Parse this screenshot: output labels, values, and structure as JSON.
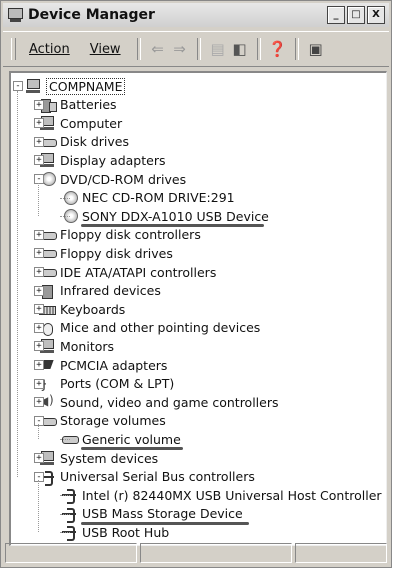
{
  "window": {
    "title": "Device Manager",
    "min_label": "_",
    "max_label": "□",
    "close_label": "X"
  },
  "menu": {
    "action": "Action",
    "view": "View"
  },
  "toolbar_icons": [
    "back-arrow-icon",
    "forward-arrow-icon",
    "properties-icon",
    "show-hide-icon",
    "help-icon",
    "scan-hardware-icon"
  ],
  "tree": {
    "root": "COMPNAME",
    "items": [
      {
        "label": "Batteries",
        "icon": "battery-icon",
        "expanded": false
      },
      {
        "label": "Computer",
        "icon": "computer-icon",
        "expanded": false
      },
      {
        "label": "Disk drives",
        "icon": "disk-drive-icon",
        "expanded": false
      },
      {
        "label": "Display adapters",
        "icon": "monitor-icon",
        "expanded": false
      },
      {
        "label": "DVD/CD-ROM drives",
        "icon": "cdrom-icon",
        "expanded": true,
        "children": [
          {
            "label": "NEC CD-ROM DRIVE:291",
            "icon": "cdrom-icon"
          },
          {
            "label": "SONY DDX-A1010 USB Device",
            "icon": "cdrom-icon",
            "underlined": true
          }
        ]
      },
      {
        "label": "Floppy disk controllers",
        "icon": "floppy-controller-icon",
        "expanded": false
      },
      {
        "label": "Floppy disk drives",
        "icon": "floppy-drive-icon",
        "expanded": false
      },
      {
        "label": "IDE ATA/ATAPI controllers",
        "icon": "ide-controller-icon",
        "expanded": false
      },
      {
        "label": "Infrared devices",
        "icon": "infrared-icon",
        "expanded": false
      },
      {
        "label": "Keyboards",
        "icon": "keyboard-icon",
        "expanded": false
      },
      {
        "label": "Mice and other pointing devices",
        "icon": "mouse-icon",
        "expanded": false
      },
      {
        "label": "Monitors",
        "icon": "monitor-icon",
        "expanded": false
      },
      {
        "label": "PCMCIA adapters",
        "icon": "pcmcia-icon",
        "expanded": false
      },
      {
        "label": "Ports (COM & LPT)",
        "icon": "port-icon",
        "expanded": false
      },
      {
        "label": "Sound, video and game controllers",
        "icon": "sound-icon",
        "expanded": false
      },
      {
        "label": "Storage volumes",
        "icon": "storage-volume-icon",
        "expanded": true,
        "children": [
          {
            "label": "Generic volume",
            "icon": "storage-volume-icon",
            "underlined": true
          }
        ]
      },
      {
        "label": "System devices",
        "icon": "computer-icon",
        "expanded": false
      },
      {
        "label": "Universal Serial Bus controllers",
        "icon": "usb-icon",
        "expanded": true,
        "children": [
          {
            "label": "Intel (r) 82440MX USB Universal Host Controller",
            "icon": "usb-icon"
          },
          {
            "label": "USB Mass Storage Device",
            "icon": "usb-icon",
            "underlined": true
          },
          {
            "label": "USB Root Hub",
            "icon": "usb-icon"
          }
        ]
      }
    ]
  },
  "colors": {
    "window_bg": "#d4d0c8",
    "highlight_underline": "#555555"
  }
}
